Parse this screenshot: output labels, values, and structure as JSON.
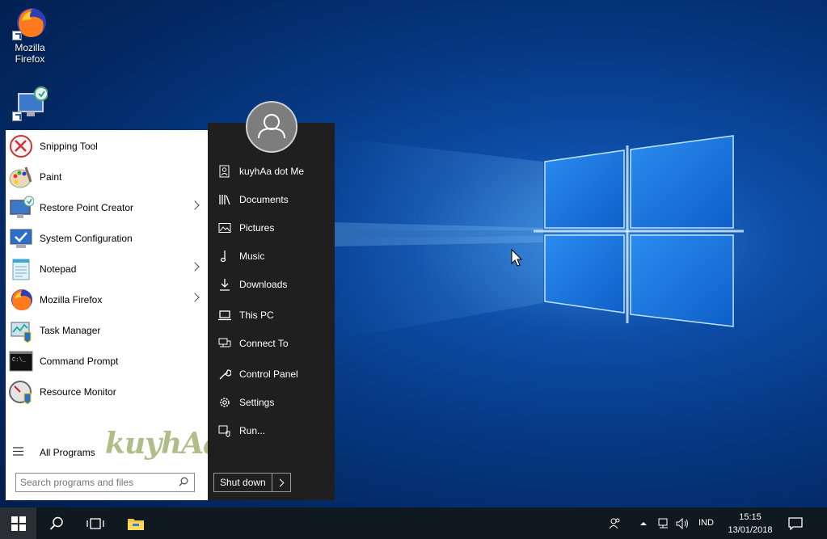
{
  "desktop": {
    "icons": [
      {
        "label": "Mozilla\nFirefox",
        "line1": "Mozilla",
        "line2": "Firefox",
        "icon": "firefox-icon"
      },
      {
        "label": "",
        "icon": "restore-point-icon"
      }
    ]
  },
  "start_menu": {
    "programs": [
      {
        "label": "Snipping Tool",
        "icon": "scissors-icon",
        "has_submenu": false
      },
      {
        "label": "Paint",
        "icon": "paint-palette-icon",
        "has_submenu": false
      },
      {
        "label": "Restore Point Creator",
        "icon": "restore-point-icon",
        "has_submenu": true
      },
      {
        "label": "System Configuration",
        "icon": "system-config-icon",
        "has_submenu": false
      },
      {
        "label": "Notepad",
        "icon": "notepad-icon",
        "has_submenu": true
      },
      {
        "label": "Mozilla Firefox",
        "icon": "firefox-icon",
        "has_submenu": true
      },
      {
        "label": "Task Manager",
        "icon": "task-manager-icon",
        "has_submenu": false
      },
      {
        "label": "Command Prompt",
        "icon": "cmd-icon",
        "has_submenu": false
      },
      {
        "label": "Resource Monitor",
        "icon": "resource-monitor-icon",
        "has_submenu": false
      }
    ],
    "all_programs": "All Programs",
    "search_placeholder": "Search programs and files",
    "right_items": [
      {
        "label": "kuyhAa dot Me",
        "icon": "user-icon"
      },
      {
        "label": "Documents",
        "icon": "documents-icon"
      },
      {
        "label": "Pictures",
        "icon": "pictures-icon"
      },
      {
        "label": "Music",
        "icon": "music-icon"
      },
      {
        "label": "Downloads",
        "icon": "download-icon"
      },
      {
        "label": "This PC",
        "icon": "computer-icon"
      },
      {
        "label": "Connect To",
        "icon": "network-icon"
      },
      {
        "label": "Control Panel",
        "icon": "wrench-icon"
      },
      {
        "label": "Settings",
        "icon": "gear-icon"
      },
      {
        "label": "Run...",
        "icon": "run-icon"
      }
    ],
    "shutdown_label": "Shut down",
    "watermark": "kuyhAa.Me"
  },
  "taskbar": {
    "language": "IND",
    "time": "15:15",
    "date": "13/01/2018"
  },
  "colors": {
    "accent": "#0a64d8",
    "start_right_bg": "#1f1f1f",
    "taskbar_bg": "#101820"
  }
}
